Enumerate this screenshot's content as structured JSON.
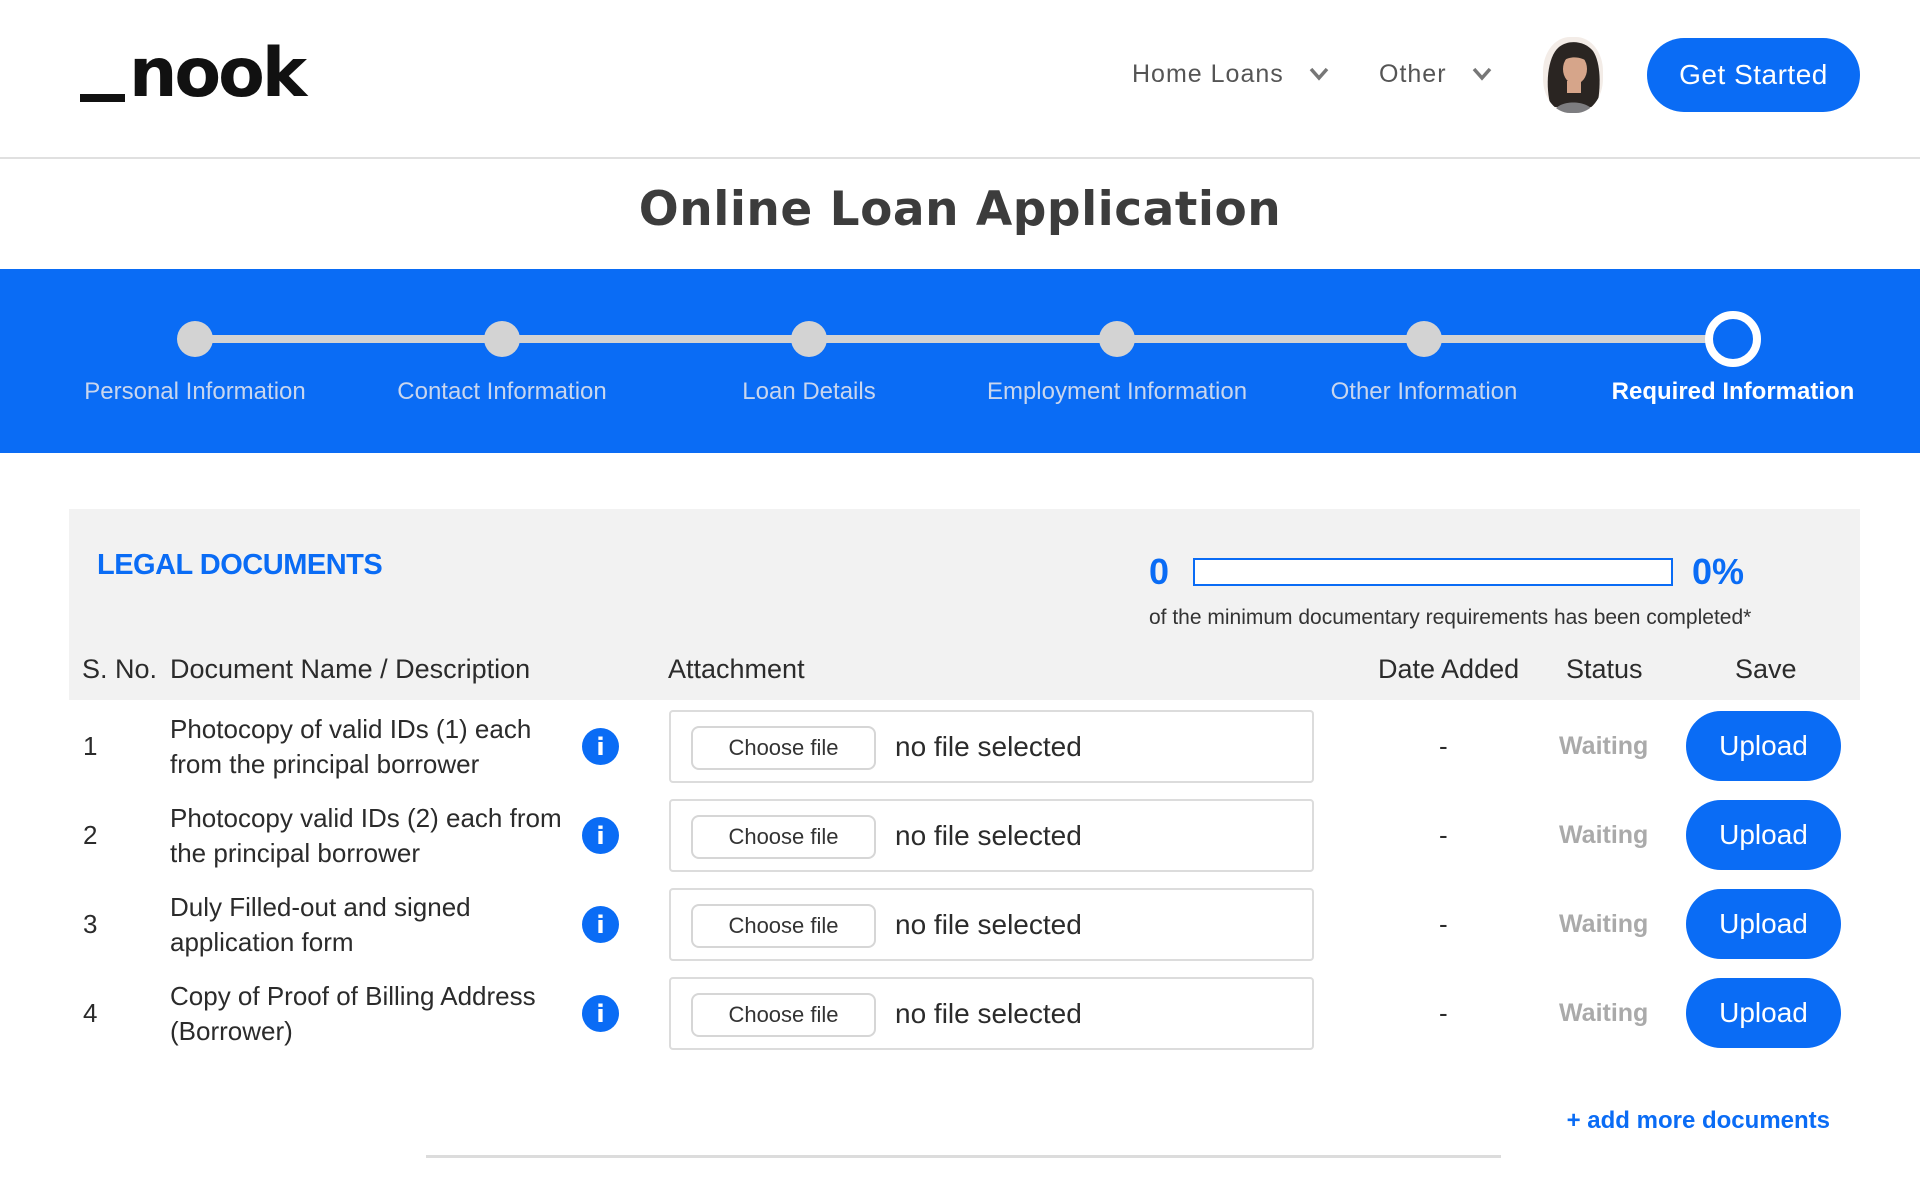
{
  "brand": {
    "logo_text": "nook",
    "accent_color": "#0a6cf5"
  },
  "nav": {
    "items": [
      {
        "label": "Home Loans",
        "icon": "chevron-down-icon"
      },
      {
        "label": "Other",
        "icon": "chevron-down-icon"
      }
    ],
    "avatar_alt": "User avatar",
    "cta_label": "Get Started"
  },
  "page": {
    "title": "Online Loan Application"
  },
  "stepper": {
    "steps": [
      {
        "label": "Personal Information",
        "state": "completed"
      },
      {
        "label": "Contact Information",
        "state": "completed"
      },
      {
        "label": "Loan Details",
        "state": "completed"
      },
      {
        "label": "Employment Information",
        "state": "completed"
      },
      {
        "label": "Other Information",
        "state": "completed"
      },
      {
        "label": "Required Information",
        "state": "active"
      }
    ]
  },
  "legal_documents": {
    "title": "LEGAL DOCUMENTS",
    "progress": {
      "count": "0",
      "percent_label": "0%",
      "percent_value": 0,
      "caption": "of the minimum documentary requirements has been completed*"
    },
    "columns": {
      "sno": "S. No.",
      "document": "Document Name / Description",
      "attachment": "Attachment",
      "date_added": "Date Added",
      "status": "Status",
      "save": "Save"
    },
    "rows": [
      {
        "sno": "1",
        "name": "Photocopy of valid IDs (1) each from the principal borrower",
        "choose_label": "Choose file",
        "file": "no file selected",
        "date_added": "-",
        "status": "Waiting",
        "action": "Upload"
      },
      {
        "sno": "2",
        "name": "Photocopy valid IDs (2) each from the principal borrower",
        "choose_label": "Choose file",
        "file": "no file selected",
        "date_added": "-",
        "status": "Waiting",
        "action": "Upload"
      },
      {
        "sno": "3",
        "name": "Duly Filled-out and signed application form",
        "choose_label": "Choose file",
        "file": "no file selected",
        "date_added": "-",
        "status": "Waiting",
        "action": "Upload"
      },
      {
        "sno": "4",
        "name": "Copy of Proof of Billing Address (Borrower)",
        "choose_label": "Choose file",
        "file": "no file selected",
        "date_added": "-",
        "status": "Waiting",
        "action": "Upload"
      }
    ],
    "add_more_label": "+ add more documents"
  }
}
